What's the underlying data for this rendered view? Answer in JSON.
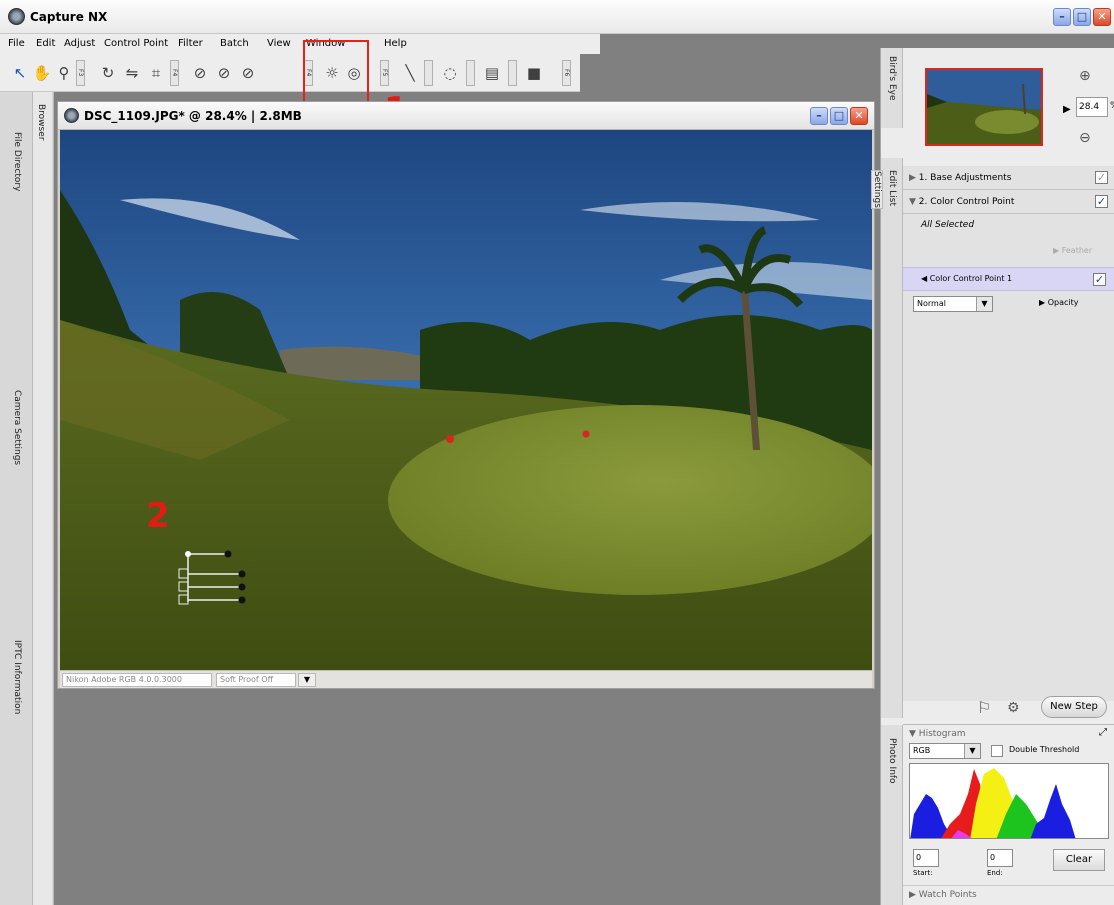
{
  "app": {
    "title": "Capture NX"
  },
  "menu": [
    "File",
    "Edit",
    "Adjust",
    "Control Point",
    "Filter",
    "Batch",
    "View",
    "Window",
    "Help"
  ],
  "toolbar": {
    "fkeys": [
      "F3",
      "F4",
      "F5",
      "F6"
    ],
    "icons": [
      "direct-select-icon",
      "hand-icon",
      "zoom-icon",
      "rotate-icon",
      "straighten-icon",
      "crop-icon",
      "black-control-point-icon",
      "neutral-control-point-icon",
      "white-control-point-icon",
      "color-control-point-icon",
      "red-eye-control-point-icon",
      "line-brush-icon",
      "lasso-icon",
      "gradient-icon",
      "fill-icon"
    ]
  },
  "annotations": {
    "label1": "1",
    "label2": "2"
  },
  "left_tabs": [
    "Browser",
    "File Directory",
    "Camera Settings",
    "IPTC Information"
  ],
  "document": {
    "title": "DSC_1109.JPG* @ 28.4% | 2.8MB",
    "profile": "Nikon Adobe RGB 4.0.0.3000",
    "soft_proof": "Soft Proof Off"
  },
  "birdseye": {
    "tab": "Bird's Eye",
    "zoom": "28.4",
    "zoom_unit": "%"
  },
  "side_tabs": {
    "settings": "Settings",
    "edit_list": "Edit List",
    "photo_info": "Photo Info"
  },
  "edit_list": {
    "step1": "1. Base Adjustments",
    "step2": "2. Color Control Point",
    "all_selected": "All Selected",
    "feather": "Feather",
    "ccp1": "Color Control Point 1",
    "blend_mode": "Normal",
    "opacity": "Opacity",
    "new_step": "New Step"
  },
  "histogram": {
    "title": "Histogram",
    "channel": "RGB",
    "double_threshold": "Double Threshold",
    "start_value": "0",
    "end_value": "0",
    "start_label": "Start:",
    "end_label": "End:",
    "clear": "Clear",
    "watch_points": "Watch Points"
  },
  "colors": {
    "highlight": "#e21c14",
    "accent": "#1a3fb0"
  }
}
